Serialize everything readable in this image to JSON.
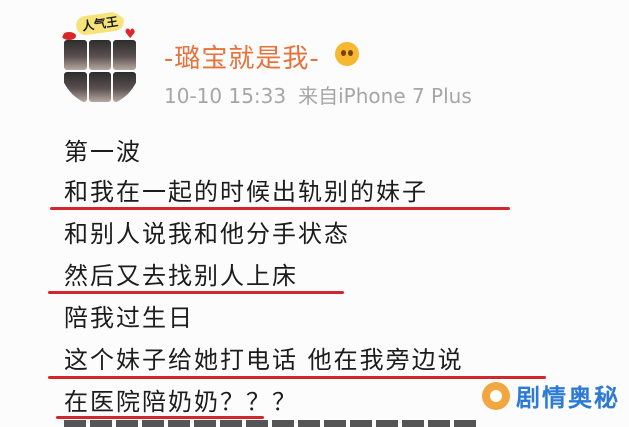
{
  "post": {
    "avatar_badge": "人气王",
    "username": "-璐宝就是我-",
    "timestamp": "10-10 15:33",
    "source": "来自iPhone 7 Plus",
    "lines": [
      "第一波",
      "和我在一起的时候出轨别的妹子",
      "和别人说我和他分手状态",
      "然后又去找别人上床",
      "陪我过生日",
      "这个妹子给她打电话 他在我旁边说",
      "在医院陪奶奶？？？"
    ]
  },
  "watermark": {
    "text": "剧情奥秘"
  },
  "colors": {
    "username": "#e8723a",
    "meta": "#a6a6a6",
    "underline": "#d3252c",
    "watermark_text": "#2b7bd6",
    "watermark_icon": "#f2a640"
  }
}
